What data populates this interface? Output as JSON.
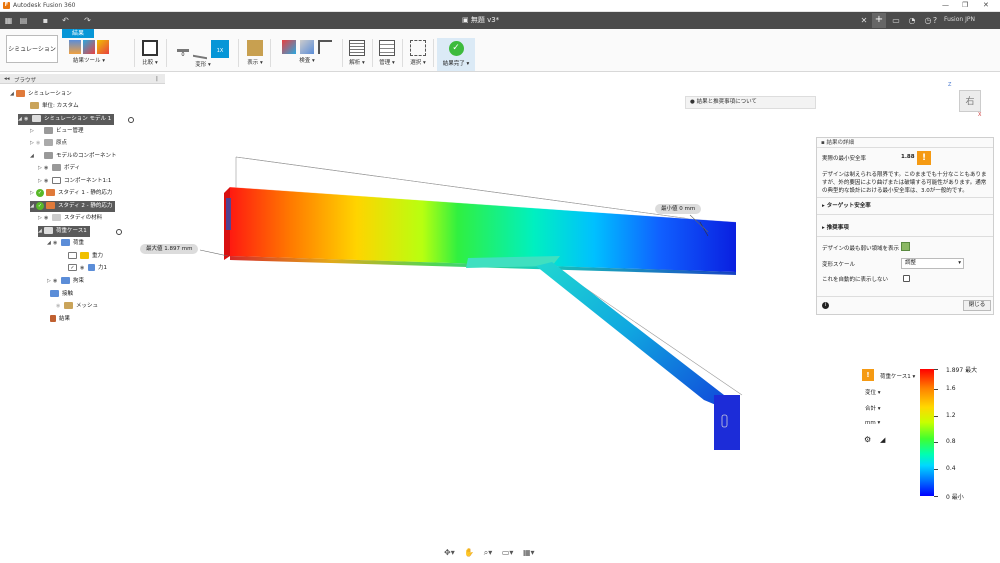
{
  "window": {
    "app_title": "Autodesk Fusion 360",
    "doc_title": "無題 v3*",
    "account": "Fusion JPN",
    "controls": [
      "—",
      "❐",
      "✕"
    ]
  },
  "ribbon": {
    "workspace": "シミュレーション",
    "active_tab": "結果",
    "groups": [
      {
        "label": "結果ツール ▾"
      },
      {
        "label": "比較 ▾"
      },
      {
        "label": "変形 ▾"
      },
      {
        "label": "表示 ▾"
      },
      {
        "label": "検査 ▾"
      },
      {
        "label": "解析 ▾"
      },
      {
        "label": "管理 ▾"
      },
      {
        "label": "選択 ▾"
      },
      {
        "label": "結果完了 ▾"
      }
    ],
    "deform_values": [
      "0",
      "1X"
    ]
  },
  "browser": {
    "title": "ブラウザ",
    "nodes": [
      {
        "label": "シミュレーション"
      },
      {
        "label": "単位: カスタム"
      },
      {
        "label": "シミュレーション モデル 1"
      },
      {
        "label": "ビュー管理"
      },
      {
        "label": "原点"
      },
      {
        "label": "モデルのコンポーネント"
      },
      {
        "label": "ボディ"
      },
      {
        "label": "コンポーネント1:1"
      },
      {
        "label": "スタディ 1 - 静的応力"
      },
      {
        "label": "スタディ 2 - 静的応力"
      },
      {
        "label": "スタディの材料"
      },
      {
        "label": "荷重ケース1"
      },
      {
        "label": "荷重"
      },
      {
        "label": "重力"
      },
      {
        "label": "力1"
      },
      {
        "label": "拘束"
      },
      {
        "label": "接触"
      },
      {
        "label": "メッシュ"
      },
      {
        "label": "結果"
      }
    ]
  },
  "canvas": {
    "tip": "結果と推奨事項について",
    "view_face": "右",
    "max_label": "最大値  1.897 mm",
    "min_label": "最小値  0 mm"
  },
  "details": {
    "title": "結果の詳細",
    "fos_label": "実際の最小安全率",
    "fos_value": "1.88",
    "warning_glyph": "!",
    "message": "デザインは制えられる限界です。このままでも十分なこともありますが、外的要因により曲げまたは破壊する可能性があります。通常の典型的な設計における最小安全率は、3.0が一般的です。",
    "section_target": "ターゲット安全率",
    "section_recommend": "推奨事項",
    "weakest_label": "デザインの最も弱い領域を表示",
    "deform_scale_label": "変形スケール",
    "deform_scale_value": "調整",
    "auto_show_label": "これを自動的に表示しない",
    "close_button": "閉じる",
    "info_glyph": "i"
  },
  "legend": {
    "loadcase": "荷重ケース1 ▾",
    "result_type": "変位",
    "component": "合計",
    "unit": "mm",
    "ticks": [
      {
        "label": "1.897 最大",
        "value": 1.897
      },
      {
        "label": "1.6",
        "value": 1.6
      },
      {
        "label": "1.2",
        "value": 1.2
      },
      {
        "label": "0.8",
        "value": 0.8
      },
      {
        "label": "0.4",
        "value": 0.4
      },
      {
        "label": "0 最小",
        "value": 0
      }
    ],
    "range": [
      0,
      1.897
    ]
  },
  "navbar": {
    "icons": [
      "orbit-icon",
      "pan-icon",
      "zoom-icon",
      "display-icon",
      "grid-icon"
    ]
  }
}
